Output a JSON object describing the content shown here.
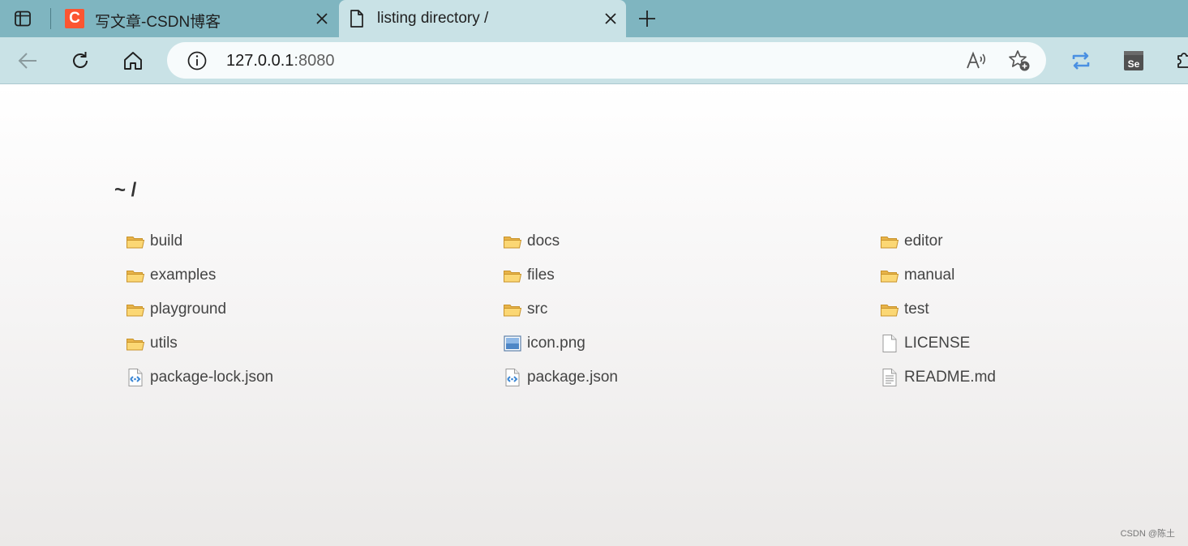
{
  "browser": {
    "tabs": [
      {
        "title": "写文章-CSDN博客",
        "favicon": "csdn-logo",
        "favicon_letter": "C",
        "active": false
      },
      {
        "title": "listing directory /",
        "favicon": "page-icon",
        "active": true
      }
    ],
    "address_bar": {
      "host": "127.0.0.1",
      "port": ":8080"
    },
    "accent_color": "#4a90e2"
  },
  "page": {
    "heading": "~ /",
    "entries": [
      {
        "name": "build",
        "type": "folder"
      },
      {
        "name": "docs",
        "type": "folder"
      },
      {
        "name": "editor",
        "type": "folder"
      },
      {
        "name": "examples",
        "type": "folder"
      },
      {
        "name": "files",
        "type": "folder"
      },
      {
        "name": "manual",
        "type": "folder"
      },
      {
        "name": "playground",
        "type": "folder"
      },
      {
        "name": "src",
        "type": "folder"
      },
      {
        "name": "test",
        "type": "folder"
      },
      {
        "name": "utils",
        "type": "folder"
      },
      {
        "name": "icon.png",
        "type": "image"
      },
      {
        "name": "LICENSE",
        "type": "file"
      },
      {
        "name": "package-lock.json",
        "type": "json"
      },
      {
        "name": "package.json",
        "type": "json"
      },
      {
        "name": "README.md",
        "type": "text"
      }
    ]
  },
  "watermark": "CSDN @陈土"
}
